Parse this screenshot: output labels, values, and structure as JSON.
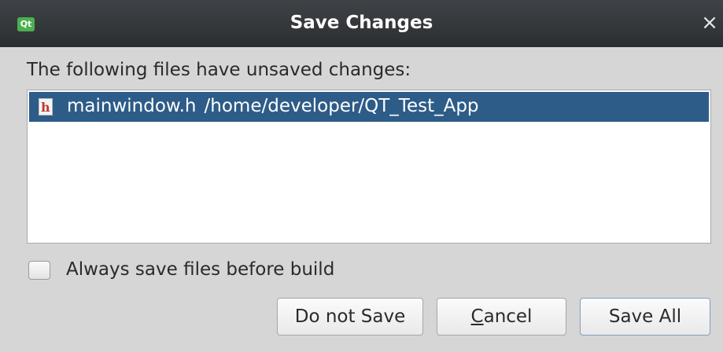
{
  "window": {
    "title": "Save Changes",
    "app_icon_text": "Qt",
    "close_glyph": "×"
  },
  "dialog": {
    "prompt": "The following files have unsaved changes:",
    "files": [
      {
        "name": "mainwindow.h",
        "path": "/home/developer/QT_Test_App",
        "icon": "header-file-icon",
        "icon_letter": "h",
        "selected": true
      }
    ],
    "checkbox_label": "Always save files before build",
    "checkbox_checked": false,
    "buttons": {
      "do_not_save": "Do not Save",
      "cancel_prefix": "C",
      "cancel_rest": "ancel",
      "save_all": "Save All"
    }
  },
  "colors": {
    "titlebar": "#2f3235",
    "selection": "#2d5c88",
    "background": "#d6d6d6"
  }
}
